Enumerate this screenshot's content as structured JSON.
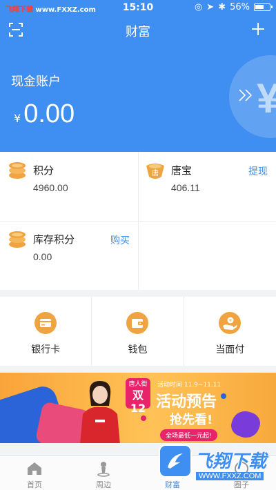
{
  "status_bar": {
    "carrier_prefix": "飞翔下载",
    "carrier_url": "www.FXXZ.com",
    "time": "15:10",
    "battery": "56%"
  },
  "nav": {
    "title": "财富",
    "scan_icon": "scan-icon",
    "add_icon": "plus-icon"
  },
  "cash_account": {
    "label": "现金账户",
    "currency": "¥",
    "amount": "0.00"
  },
  "points": [
    {
      "name": "积分",
      "value": "4960.00",
      "action": "",
      "icon": "coin-stack-icon"
    },
    {
      "name": "唐宝",
      "value": "406.11",
      "action": "提现",
      "icon": "tangbao-icon",
      "icon_text": "唐"
    },
    {
      "name": "库存积分",
      "value": "0.00",
      "action": "购买",
      "icon": "coin-stack-icon"
    }
  ],
  "shortcuts": [
    {
      "label": "银行卡",
      "icon": "bank-card-icon"
    },
    {
      "label": "钱包",
      "icon": "wallet-icon"
    },
    {
      "label": "当面付",
      "icon": "face-pay-icon"
    }
  ],
  "banner": {
    "badge_top": "唐人街",
    "badge_main": "双12",
    "period": "活动时间 11.9~11.11",
    "headline": "活动预告",
    "subline": "抢先看!",
    "pill": "全场最低一元起!"
  },
  "tabs": [
    {
      "label": "首页",
      "icon": "home-icon",
      "active": false
    },
    {
      "label": "周边",
      "icon": "nearby-icon",
      "active": false
    },
    {
      "label": "财富",
      "icon": "wealth-icon",
      "active": true
    },
    {
      "label": "圈子",
      "icon": "circle-icon",
      "active": false
    }
  ],
  "watermark": {
    "text": "飞翔下载",
    "url": "WWW.FXXZ.COM"
  },
  "colors": {
    "primary": "#3f8ef1",
    "coin": "#f0a441",
    "banner": "#ffc256",
    "badge": "#e8236a"
  }
}
